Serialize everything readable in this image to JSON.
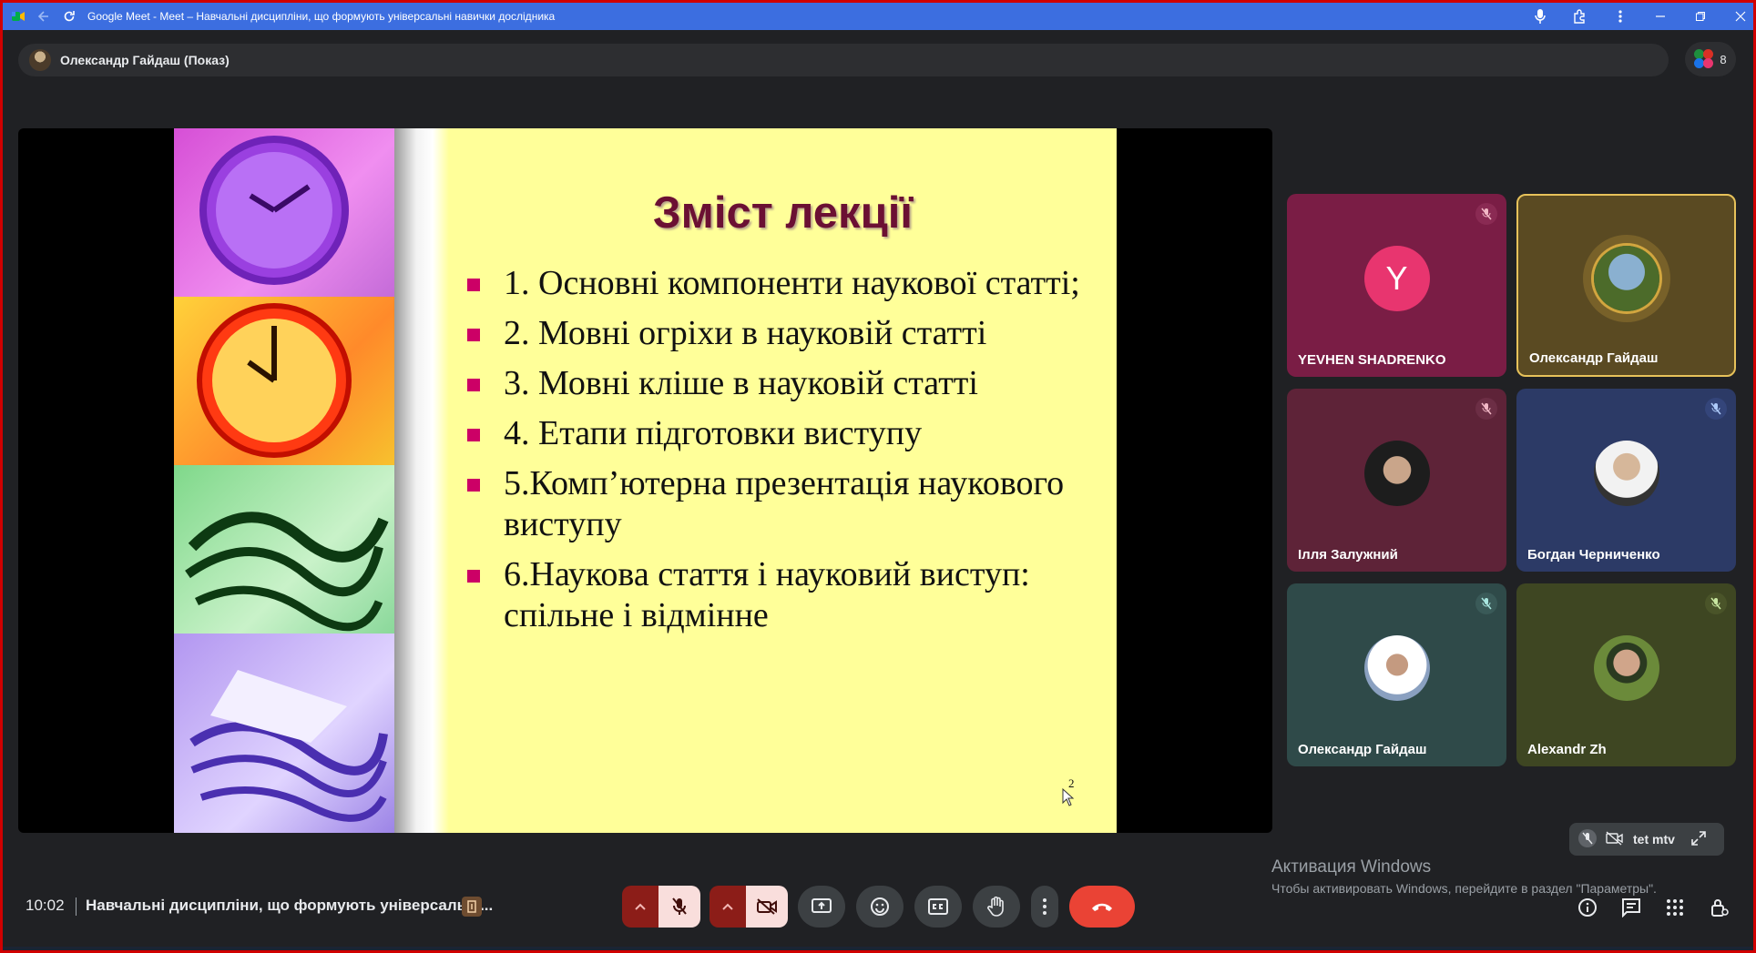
{
  "browser": {
    "window_title": "Google Meet - Meet – Навчальні дисципліни, що формують універсальні навички дослідника"
  },
  "presentation": {
    "presenter_label": "Олександр Гайдаш (Показ)",
    "participants_count": "8"
  },
  "slide": {
    "title": "Зміст лекції",
    "bullets": [
      "1. Основні компоненти наукової статті;",
      "2. Мовні огріхи в науковій статті",
      "3. Мовні кліше в науковій статті",
      "4. Етапи підготовки виступу",
      "5.Комп’ютерна презентація наукового виступу",
      "6.Наукова стаття і науковий виступ: спільне і відмінне"
    ],
    "page_number": "2"
  },
  "participants": [
    {
      "name": "YEVHEN SHADRENKO",
      "initial": "Y",
      "muted": true,
      "bg": "#7a1d45",
      "avatar_color": "#e8356f"
    },
    {
      "name": "Олександр Гайдаш",
      "initial": "",
      "muted": false,
      "speaking": true,
      "bg": "#5a4a22",
      "avatar_color": "#c49a3a"
    },
    {
      "name": "Ілля Залужний",
      "initial": "",
      "muted": true,
      "bg": "#5e2338",
      "avatar_color": "#222222"
    },
    {
      "name": "Богдан Черниченко",
      "initial": "",
      "muted": true,
      "bg": "#2c3a66",
      "avatar_color": "#e6e6e6"
    },
    {
      "name": "Олександр Гайдаш",
      "initial": "",
      "muted": true,
      "bg": "#2f4a49",
      "avatar_color": "#ffffff"
    },
    {
      "name": "Alexandr Zh",
      "initial": "",
      "muted": true,
      "bg": "#3e4622",
      "avatar_color": "#6b8a3a"
    }
  ],
  "self_view": {
    "label": "tet mtv"
  },
  "windows_activation": {
    "line1": "Активация Windows",
    "line2": "Чтобы активировать Windows, перейдите в раздел \"Параметры\"."
  },
  "bottom_bar": {
    "time": "10:02",
    "meeting_name": "Навчальні дисципліни, що формують універсальні...",
    "icons": [
      "chevron-up-icon",
      "mic-off-icon",
      "chevron-up-icon",
      "camera-off-icon",
      "present-icon",
      "emoji-icon",
      "captions-icon",
      "raise-hand-icon",
      "more-icon",
      "end-call-icon",
      "info-icon",
      "chat-icon",
      "activities-icon",
      "host-controls-icon"
    ]
  },
  "colors": {
    "accent_blue": "#3c6ee0",
    "end_call_red": "#ea4335",
    "slide_bg": "#ffff99",
    "slide_title": "#6b1033",
    "bullet": "#cc0066"
  }
}
